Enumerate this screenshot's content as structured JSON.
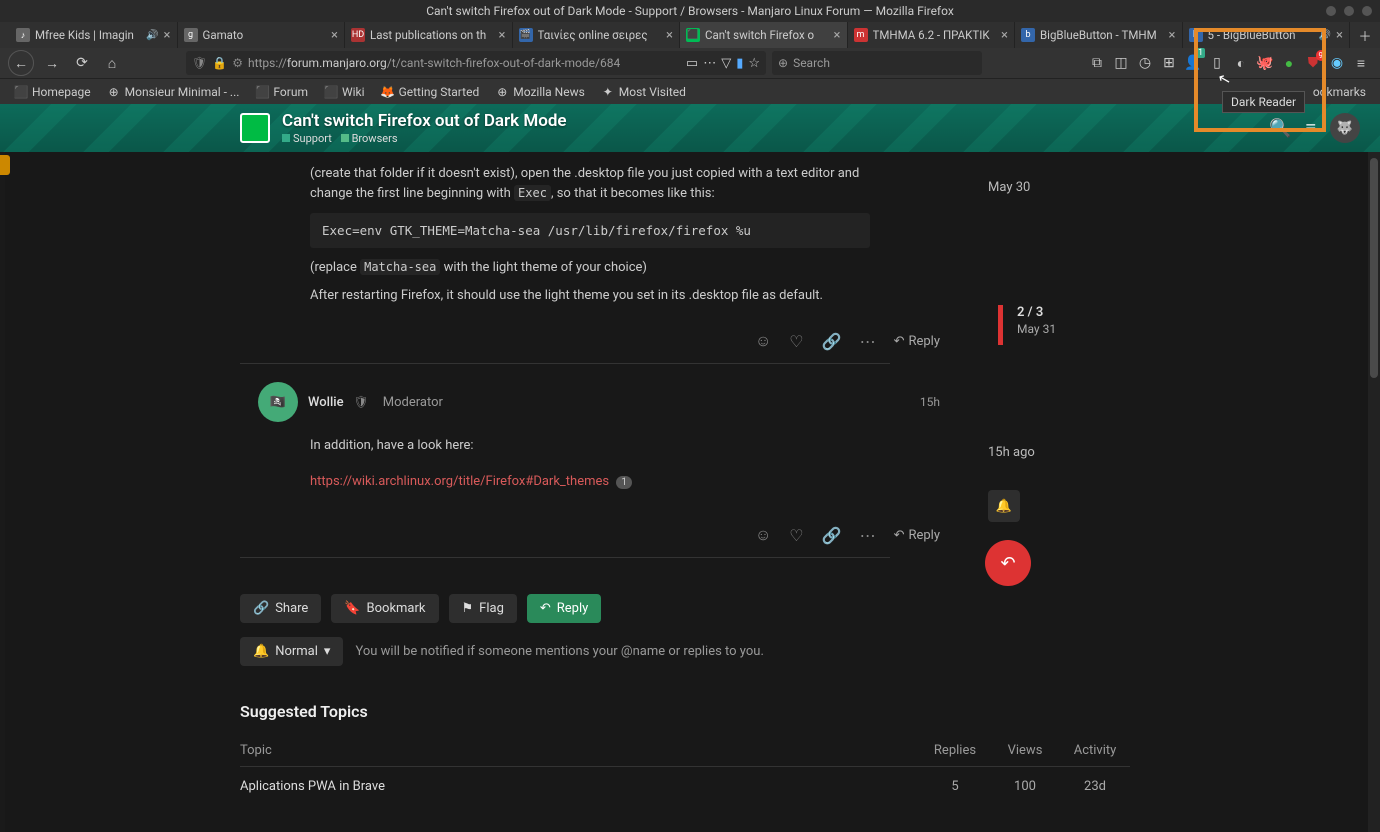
{
  "window": {
    "title": "Can't switch Firefox out of Dark Mode - Support / Browsers - Manjaro Linux Forum — Mozilla Firefox"
  },
  "tabs": [
    {
      "label": "Mfree Kids | Imagin",
      "audio": true
    },
    {
      "label": "Gamato",
      "audio": false
    },
    {
      "label": "Last publications on th",
      "audio": false
    },
    {
      "label": "Ταινίες online σειρες",
      "audio": false
    },
    {
      "label": "Can't switch Firefox o",
      "audio": false,
      "active": true
    },
    {
      "label": "ΤΜΗΜΑ 6.2 - ΠΡΑΚΤΙΚ",
      "audio": false
    },
    {
      "label": "BigBlueButton - ΤΜΗΜ",
      "audio": false
    },
    {
      "label": "5 - BigBlueButton",
      "audio": true
    }
  ],
  "url": {
    "scheme": "https://",
    "host": "forum.manjaro.org",
    "path": "/t/cant-switch-firefox-out-of-dark-mode/684"
  },
  "search_placeholder": "Search",
  "tooltip": "Dark Reader",
  "ext_badge_1": "1",
  "ext_badge_9": "9",
  "bookmarks": [
    "Homepage",
    "Monsieur Minimal - ...",
    "Forum",
    "Wiki",
    "Getting Started",
    "Mozilla News",
    "Most Visited"
  ],
  "other_bookmarks_suffix": "ookmarks",
  "forum": {
    "title": "Can't switch Firefox out of Dark Mode",
    "cat1": "Support",
    "cat2": "Browsers"
  },
  "post1": {
    "p1a": "(create that folder if it doesn't exist), open the .desktop file you just copied with a text editor and change the first line beginning with ",
    "p1code": "Exec",
    "p1b": ", so that it becomes like this:",
    "codeblock": "Exec=env GTK_THEME=Matcha-sea /usr/lib/firefox/firefox %u",
    "p2a": "(replace ",
    "p2code": "Matcha-sea",
    "p2b": " with the light theme of your choice)",
    "p3": "After restarting Firefox, it should use the light theme you set in its .desktop file as default."
  },
  "post2": {
    "user": "Wollie",
    "role": "Moderator",
    "time": "15h",
    "text": "In addition, have a look here:",
    "link": "https://wiki.archlinux.org/title/Firefox#Dark_themes",
    "linkcount": "1"
  },
  "actions": {
    "reply": "Reply"
  },
  "controls": {
    "share": "Share",
    "bookmark": "Bookmark",
    "flag": "Flag",
    "reply": "Reply",
    "normal": "Normal",
    "notif": "You will be notified if someone mentions your @name or replies to you."
  },
  "suggested": {
    "heading": "Suggested Topics",
    "cols": {
      "topic": "Topic",
      "replies": "Replies",
      "views": "Views",
      "activity": "Activity"
    },
    "row1": {
      "title": "Aplications PWA in Brave",
      "replies": "5",
      "views": "100",
      "activity": "23d"
    }
  },
  "timeline": {
    "top": "May 30",
    "scrub_main": "2 / 3",
    "scrub_sub": "May 31",
    "bottom": "15h ago"
  }
}
